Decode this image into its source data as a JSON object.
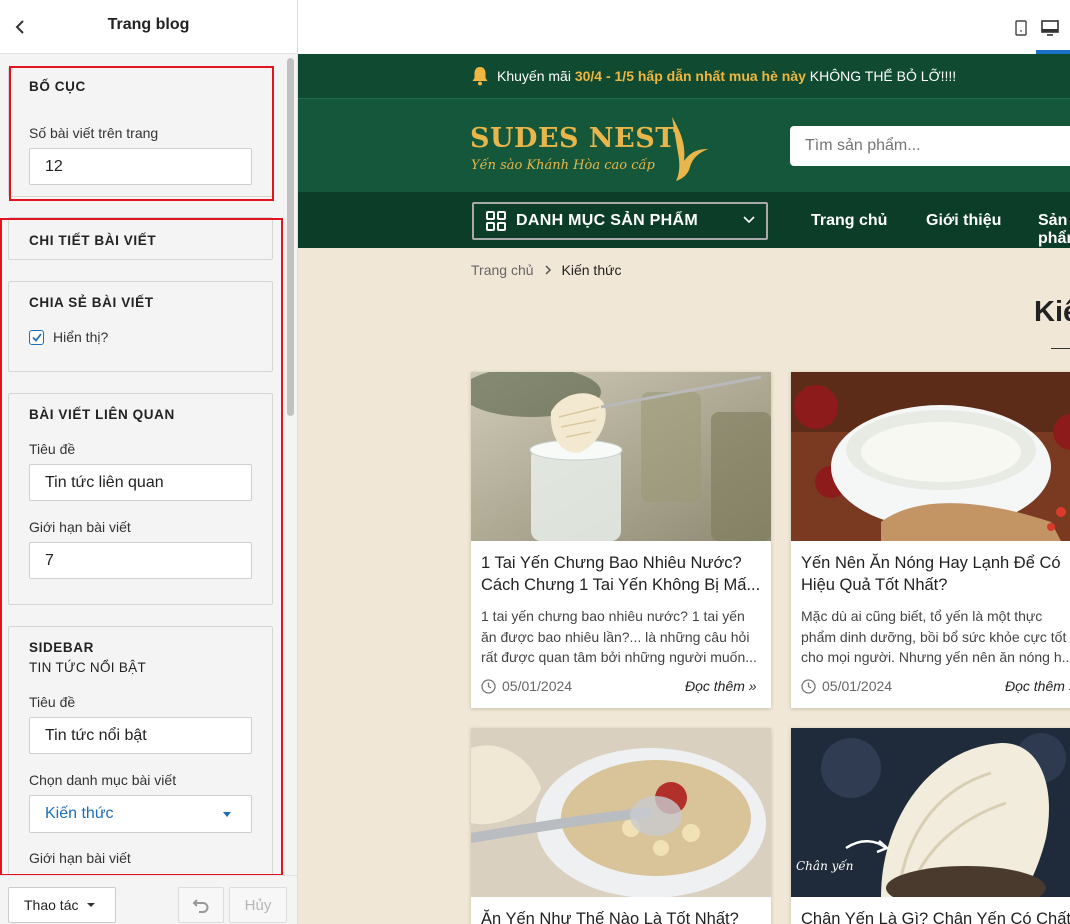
{
  "editor": {
    "title": "Trang blog",
    "layout": {
      "title": "BỐ CỤC",
      "posts_per_page_label": "Số bài viết trên trang",
      "posts_per_page": "12"
    },
    "post_detail": {
      "title": "CHI TIẾT BÀI VIẾT"
    },
    "share": {
      "title": "CHIA SẺ BÀI VIẾT",
      "show_label": "Hiển thị?",
      "show_checked": true
    },
    "related": {
      "title": "BÀI VIẾT LIÊN QUAN",
      "heading_label": "Tiêu đề",
      "heading_value": "Tin tức liên quan",
      "limit_label": "Giới hạn bài viết",
      "limit_value": "7"
    },
    "sidebar": {
      "title": "SIDEBAR",
      "subtitle": "TIN TỨC NỔI BẬT",
      "heading_label": "Tiêu đề",
      "heading_value": "Tin tức nổi bật",
      "category_label": "Chọn danh mục bài viết",
      "category_value": "Kiến thức",
      "limit_label": "Giới hạn bài viết"
    },
    "footer": {
      "actions_label": "Thao tác",
      "cancel_label": "Hủy"
    }
  },
  "preview": {
    "promo": {
      "prefix": "Khuyến mãi ",
      "highlight": "30/4 - 1/5 hấp dẫn nhất mua hè này",
      "suffix": " KHÔNG THỂ BỎ LỠ!!!!"
    },
    "logo": {
      "name": "SUDES NEST",
      "tagline": "Yến sào Khánh Hòa cao cấp"
    },
    "search_placeholder": "Tìm sản phẩm...",
    "category_button": "DANH MỤC SẢN PHẨM",
    "nav": [
      "Trang chủ",
      "Giới thiệu",
      "Sản phẩm"
    ],
    "breadcrumb": {
      "home": "Trang chủ",
      "current": "Kiến thức"
    },
    "page_title": "Kiến thức",
    "posts": [
      {
        "title": "1 Tai Yến Chưng Bao Nhiêu Nước?\nCách Chưng 1 Tai Yến Không Bị Mấ...",
        "excerpt": "1 tai yến chưng bao nhiêu nước? 1 tai yến\năn được bao nhiêu lần?... là những câu hỏi\nrất được quan tâm bởi những người muốn...",
        "date": "05/01/2024",
        "read_more": "Đọc thêm »"
      },
      {
        "title": "Yến Nên Ăn Nóng Hay Lạnh Để Có\nHiệu Quả Tốt Nhất?",
        "excerpt": "Mặc dù ai cũng biết, tổ yến là một thực\nphẩm dinh dưỡng, bồi bổ sức khỏe cực tốt\ncho mọi người. Nhưng yến nên ăn nóng h...",
        "date": "05/01/2024",
        "read_more": "Đọc thêm »"
      },
      {
        "title": "Ăn Yến Như Thế Nào Là Tốt Nhất?"
      },
      {
        "title": "Chân Yến Là Gì? Chân Yến Có Chất",
        "image_caption": "Chân yến"
      }
    ]
  }
}
